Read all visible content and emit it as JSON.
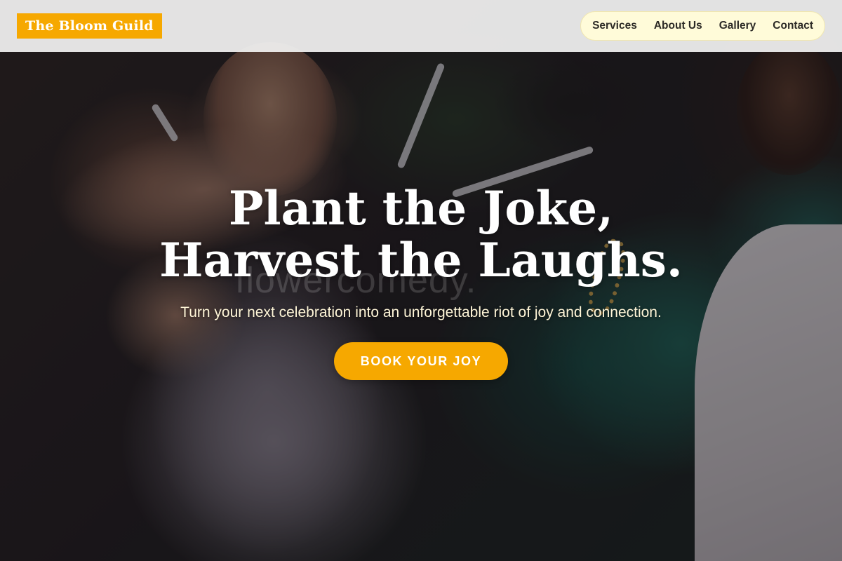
{
  "header": {
    "logo_text": "The Bloom Guild",
    "nav": {
      "items": [
        {
          "label": "Services"
        },
        {
          "label": "About Us"
        },
        {
          "label": "Gallery"
        },
        {
          "label": "Contact"
        }
      ]
    }
  },
  "hero": {
    "title": "Plant the Joke, Harvest the Laughs.",
    "subtitle": "Turn your next celebration into an unforgettable riot of joy and connection.",
    "cta_label": "BOOK YOUR JOY",
    "watermark_text": "flowercomedy.",
    "background_image": "party-guests-toasting-drinks-photo"
  },
  "colors": {
    "accent": "#f6a800",
    "header_bg": "#f2f2f2",
    "nav_bg": "#fffbd9",
    "hero_title": "#ffffff",
    "hero_subtitle": "#fff6d8"
  }
}
